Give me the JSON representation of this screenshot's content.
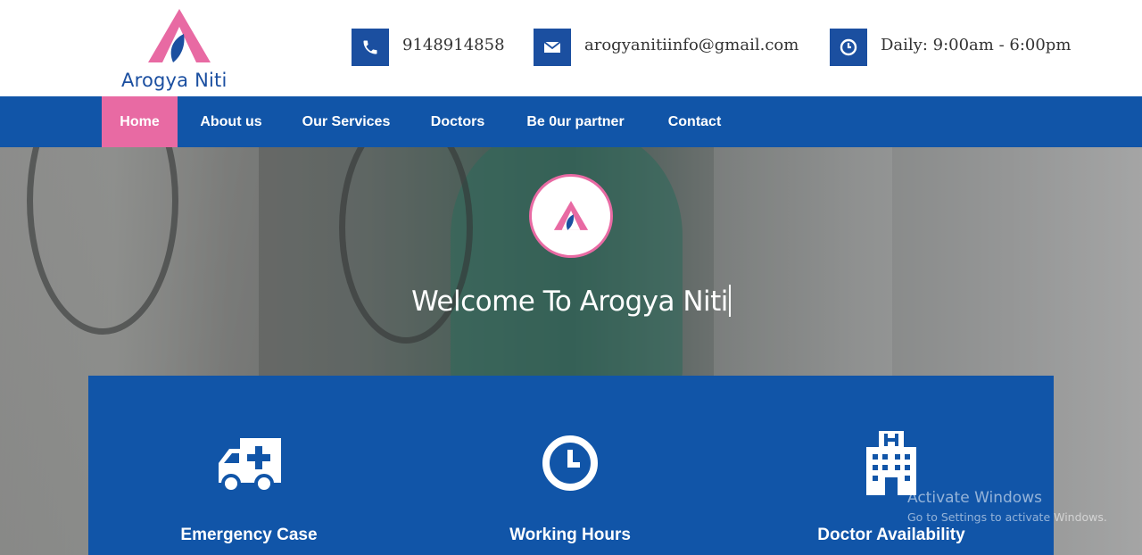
{
  "brand": {
    "name": "Arogya Niti",
    "primary_color": "#1155a8",
    "accent_color": "#e86aa3"
  },
  "contact": {
    "phone": {
      "icon": "phone-icon",
      "text": "9148914858"
    },
    "email": {
      "icon": "envelope-icon",
      "text": "arogyanitiinfo@gmail.com"
    },
    "hours": {
      "icon": "clock-icon",
      "text": "Daily: 9:00am - 6:00pm"
    }
  },
  "nav": {
    "items": [
      {
        "label": "Home",
        "active": true
      },
      {
        "label": "About us"
      },
      {
        "label": "Our Services"
      },
      {
        "label": "Doctors"
      },
      {
        "label": "Be 0ur partner"
      },
      {
        "label": "Contact"
      }
    ]
  },
  "hero": {
    "heading": "Welcome To Arogya Niti",
    "background": "doctors-photo"
  },
  "features": [
    {
      "icon": "ambulance-icon",
      "title": "Emergency Case"
    },
    {
      "icon": "clock-icon",
      "title": "Working Hours"
    },
    {
      "icon": "hospital-icon",
      "title": "Doctor Availability"
    }
  ],
  "watermark": {
    "line1": "Activate Windows",
    "line2": "Go to Settings to activate Windows."
  }
}
